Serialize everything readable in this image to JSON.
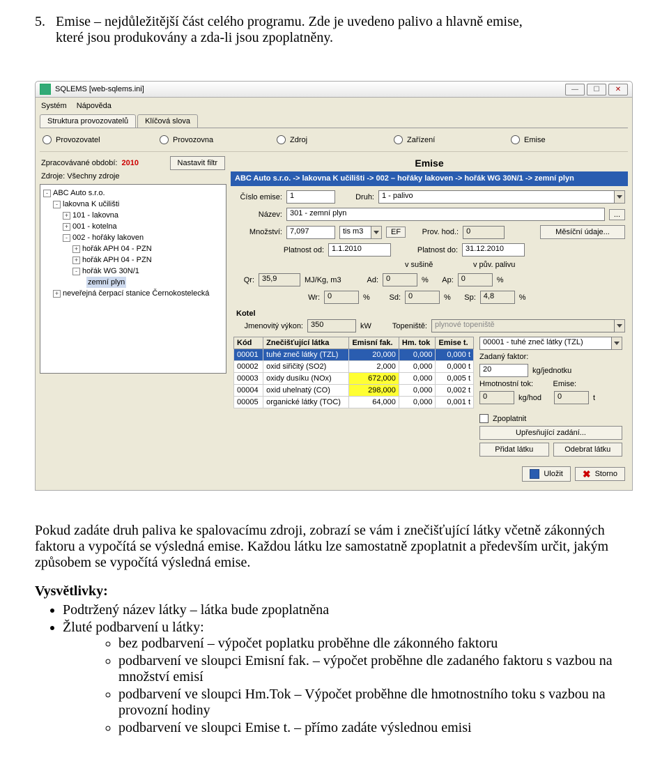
{
  "intro": {
    "num": "5.",
    "line1": "Emise – nejdůležitější část celého programu. Zde je uvedeno palivo a hlavně emise,",
    "line2": "které jsou produkovány a zda-li jsou zpoplatněny."
  },
  "titlebar": {
    "text": "SQLEMS [web-sqlems.ini]"
  },
  "menu": {
    "system": "Systém",
    "help": "Nápověda"
  },
  "tabs": {
    "t1": "Struktura provozovatelů",
    "t2": "Klíčová slova"
  },
  "radios": {
    "r1": "Provozovatel",
    "r2": "Provozovna",
    "r3": "Zdroj",
    "r4": "Zařízení",
    "r5": "Emise"
  },
  "leftpane": {
    "period_lbl": "Zpracovávané období:",
    "period_val": "2010",
    "sources_lbl": "Zdroje: Všechny zdroje",
    "filter_btn": "Nastavit filtr",
    "tree": {
      "n1": "ABC Auto s.r.o.",
      "n2": "lakovna K učilišti",
      "n3": "101 - lakovna",
      "n4": "001 - kotelna",
      "n5": "002 - hořáky lakoven",
      "n6": "hořák APH 04 - PZN",
      "n7": "hořák APH 04 - PZN",
      "n8": "hořák  WG 30N/1",
      "n9": "zemní plyn",
      "n10": "neveřejná čerpací stanice Černokostelecká"
    }
  },
  "rp": {
    "title": "Emise",
    "crumb": "ABC Auto s.r.o. -> lakovna K učilišti -> 002 – hořáky lakoven -> hořák  WG 30N/1 -> zemní plyn",
    "cislo_lbl": "Číslo emise:",
    "cislo_val": "1",
    "druh_lbl": "Druh:",
    "druh_val": "1 - palivo",
    "nazev_lbl": "Název:",
    "nazev_val": "301 - zemní plyn",
    "mnoz_lbl": "Množství:",
    "mnoz_val": "7,097",
    "mnoz_unit": "tis m3",
    "ef_lbl": "EF",
    "provhod_lbl": "Prov. hod.:",
    "provhod_val": "0",
    "mesicni_btn": "Měsíční údaje...",
    "plat_od_lbl": "Platnost od:",
    "plat_od_val": "1.1.2010",
    "plat_do_lbl": "Platnost do:",
    "plat_do_val": "31.12.2010",
    "vsus_lbl": "v sušině",
    "vpuv_lbl": "v pův. palivu",
    "qr_lbl": "Qr:",
    "qr_val": "35,9",
    "qr_unit": "MJ/Kg, m3",
    "ad_lbl": "Ad:",
    "ad_val": "0",
    "ap_lbl": "Ap:",
    "ap_val": "0",
    "wr_lbl": "Wr:",
    "wr_val": "0",
    "sd_lbl": "Sd:",
    "sd_val": "0",
    "sp_lbl": "Sp:",
    "sp_val": "4,8",
    "pct": "%",
    "kotel_title": "Kotel",
    "jmen_lbl": "Jmenovitý výkon:",
    "jmen_val": "350",
    "jmen_unit": "kW",
    "top_lbl": "Topeniště:",
    "top_val": "plynové topeniště"
  },
  "table": {
    "h1": "Kód",
    "h2": "Znečišťující látka",
    "h3": "Emisní fak.",
    "h4": "Hm. tok",
    "h5": "Emise t.",
    "rows": [
      {
        "kod": "00001",
        "latka": "tuhé zneč látky (TZL)",
        "ef": "20,000",
        "hm": "0,000",
        "et": "0,000 t",
        "sel": true
      },
      {
        "kod": "00002",
        "latka": "oxid siřičitý (SO2)",
        "ef": "2,000",
        "hm": "0,000",
        "et": "0,000 t"
      },
      {
        "kod": "00003",
        "latka": "oxidy dusíku  (NOx)",
        "ef": "672,000",
        "hm": "0,000",
        "et": "0,005 t",
        "yel": true
      },
      {
        "kod": "00004",
        "latka": "oxid uhelnatý (CO)",
        "ef": "298,000",
        "hm": "0,000",
        "et": "0,002 t",
        "yel": true
      },
      {
        "kod": "00005",
        "latka": "organické látky (TOC)",
        "ef": "64,000",
        "hm": "0,000",
        "et": "0,001 t"
      }
    ]
  },
  "side": {
    "combo": "00001 - tuhé zneč látky (TZL)",
    "zf_lbl": "Zadaný faktor:",
    "zf_val": "20",
    "zf_unit": "kg/jednotku",
    "hm_lbl": "Hmotnostní tok:",
    "em_lbl": "Emise:",
    "hm_val": "0",
    "hm_unit": "kg/hod",
    "em_val": "0",
    "em_unit": "t",
    "zpo_lbl": "Zpoplatnit",
    "upres_btn": "Upřesňující zadání...",
    "add_btn": "Přidat látku",
    "del_btn": "Odebrat látku"
  },
  "bottom": {
    "save": "Uložit",
    "cancel": "Storno"
  },
  "para1": "Pokud zadáte druh paliva ke spalovacímu zdroji, zobrazí se vám i znečišťující látky včetně zákonných faktoru a vypočítá se výsledná emise. Každou látku lze samostatně zpoplatnit a především určit, jakým způsobem se vypočítá výsledná emise.",
  "vysv": {
    "head": "Vysvětlivky:",
    "b1": "Podtržený název látky – látka bude zpoplatněna",
    "b2": "Žluté podbarvení u látky:",
    "s1": "bez podbarvení – výpočet poplatku proběhne dle zákonného faktoru",
    "s2": "podbarvení ve sloupci Emisní fak. – výpočet proběhne dle zadaného faktoru s vazbou na množství emisí",
    "s3": "podbarvení ve sloupci Hm.Tok – Výpočet proběhne dle hmotnostního toku s vazbou na provozní hodiny",
    "s4": "podbarvení ve sloupci Emise t. – přímo zadáte výslednou emisi"
  }
}
